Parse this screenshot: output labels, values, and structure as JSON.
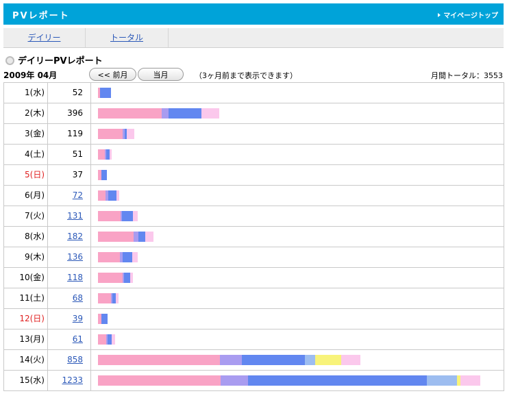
{
  "header": {
    "title": "PVレポート",
    "mypage_link": "マイページトップ"
  },
  "tabs": [
    {
      "label": "デイリー"
    },
    {
      "label": "トータル"
    }
  ],
  "report": {
    "title": "デイリーPVレポート",
    "month": "2009年 04月",
    "prev_button": "<< 前月",
    "current_button": "当月",
    "note": "（3ヶ月前まで表示できます）",
    "total": "月間トータル：3553"
  },
  "colors": {
    "segments": [
      "#f9a3c5",
      "#a99cf0",
      "#6287f0",
      "#9dbdf0",
      "#f8f37a",
      "#fbc8ec"
    ],
    "sunday": "#e02020",
    "header_bg": "#00a3d9",
    "link": "#2b58b8"
  },
  "rows": [
    {
      "date": "1(水)",
      "pv": "52",
      "link": false,
      "holiday": false,
      "segments": [
        3,
        0,
        16,
        0,
        0,
        0
      ]
    },
    {
      "date": "2(木)",
      "pv": "396",
      "link": false,
      "holiday": false,
      "segments": [
        93,
        10,
        48,
        0,
        0,
        26
      ]
    },
    {
      "date": "3(金)",
      "pv": "119",
      "link": false,
      "holiday": false,
      "segments": [
        36,
        3,
        3,
        0,
        0,
        11
      ]
    },
    {
      "date": "4(土)",
      "pv": "51",
      "link": false,
      "holiday": false,
      "segments": [
        10,
        2,
        5,
        0,
        0,
        3
      ]
    },
    {
      "date": "5(日)",
      "pv": "37",
      "link": false,
      "holiday": true,
      "segments": [
        5,
        0,
        8,
        0,
        0,
        0
      ]
    },
    {
      "date": "6(月)",
      "pv": "72",
      "link": true,
      "holiday": false,
      "segments": [
        11,
        4,
        12,
        0,
        0,
        4
      ]
    },
    {
      "date": "7(火)",
      "pv": "131",
      "link": true,
      "holiday": false,
      "segments": [
        33,
        2,
        16,
        0,
        0,
        7
      ]
    },
    {
      "date": "8(水)",
      "pv": "182",
      "link": true,
      "holiday": false,
      "segments": [
        52,
        7,
        10,
        0,
        0,
        12
      ]
    },
    {
      "date": "9(木)",
      "pv": "136",
      "link": true,
      "holiday": false,
      "segments": [
        32,
        4,
        14,
        0,
        0,
        8
      ]
    },
    {
      "date": "10(金)",
      "pv": "118",
      "link": true,
      "holiday": false,
      "segments": [
        36,
        2,
        9,
        0,
        0,
        4
      ]
    },
    {
      "date": "11(土)",
      "pv": "68",
      "link": true,
      "holiday": false,
      "segments": [
        19,
        2,
        5,
        0,
        0,
        4
      ]
    },
    {
      "date": "12(日)",
      "pv": "39",
      "link": true,
      "holiday": true,
      "segments": [
        5,
        0,
        9,
        0,
        0,
        0
      ]
    },
    {
      "date": "13(月)",
      "pv": "61",
      "link": true,
      "holiday": false,
      "segments": [
        12,
        2,
        6,
        0,
        0,
        5
      ]
    },
    {
      "date": "14(火)",
      "pv": "858",
      "link": true,
      "holiday": false,
      "segments": [
        178,
        32,
        92,
        15,
        38,
        28
      ]
    },
    {
      "date": "15(水)",
      "pv": "1233",
      "link": true,
      "holiday": false,
      "segments": [
        179,
        40,
        261,
        44,
        5,
        29
      ]
    }
  ]
}
